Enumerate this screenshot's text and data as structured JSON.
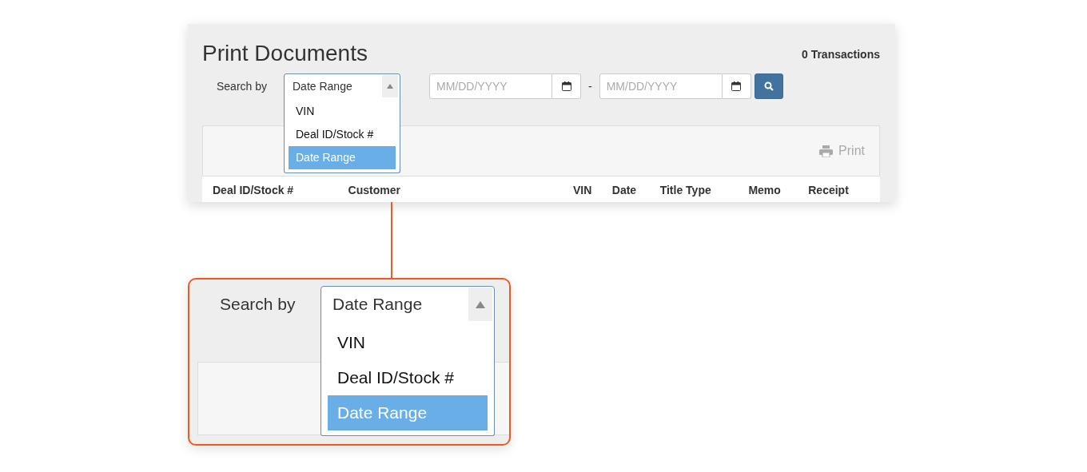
{
  "panel": {
    "title": "Print Documents",
    "count": "0 Transactions",
    "search_label": "Search by",
    "search_select": {
      "value": "Date Range",
      "expanded": true,
      "options": [
        {
          "label": "VIN",
          "selected": false
        },
        {
          "label": "Deal ID/Stock #",
          "selected": false
        },
        {
          "label": "Date Range",
          "selected": true
        }
      ]
    },
    "date_from": {
      "placeholder": "MM/DD/YYYY"
    },
    "separator": "-",
    "date_to": {
      "placeholder": "MM/DD/YYYY"
    },
    "print_button": {
      "label": "Print",
      "disabled": true
    },
    "table": {
      "columns": [
        "Deal ID/Stock #",
        "Customer",
        "VIN",
        "Date",
        "Title Type",
        "Memo",
        "Receipt"
      ]
    }
  },
  "callout": {
    "search_label": "Search by",
    "search_select": {
      "value": "Date Range",
      "expanded": true,
      "options": [
        {
          "label": "VIN",
          "selected": false
        },
        {
          "label": "Deal ID/Stock #",
          "selected": false
        },
        {
          "label": "Date Range",
          "selected": true
        }
      ]
    }
  }
}
